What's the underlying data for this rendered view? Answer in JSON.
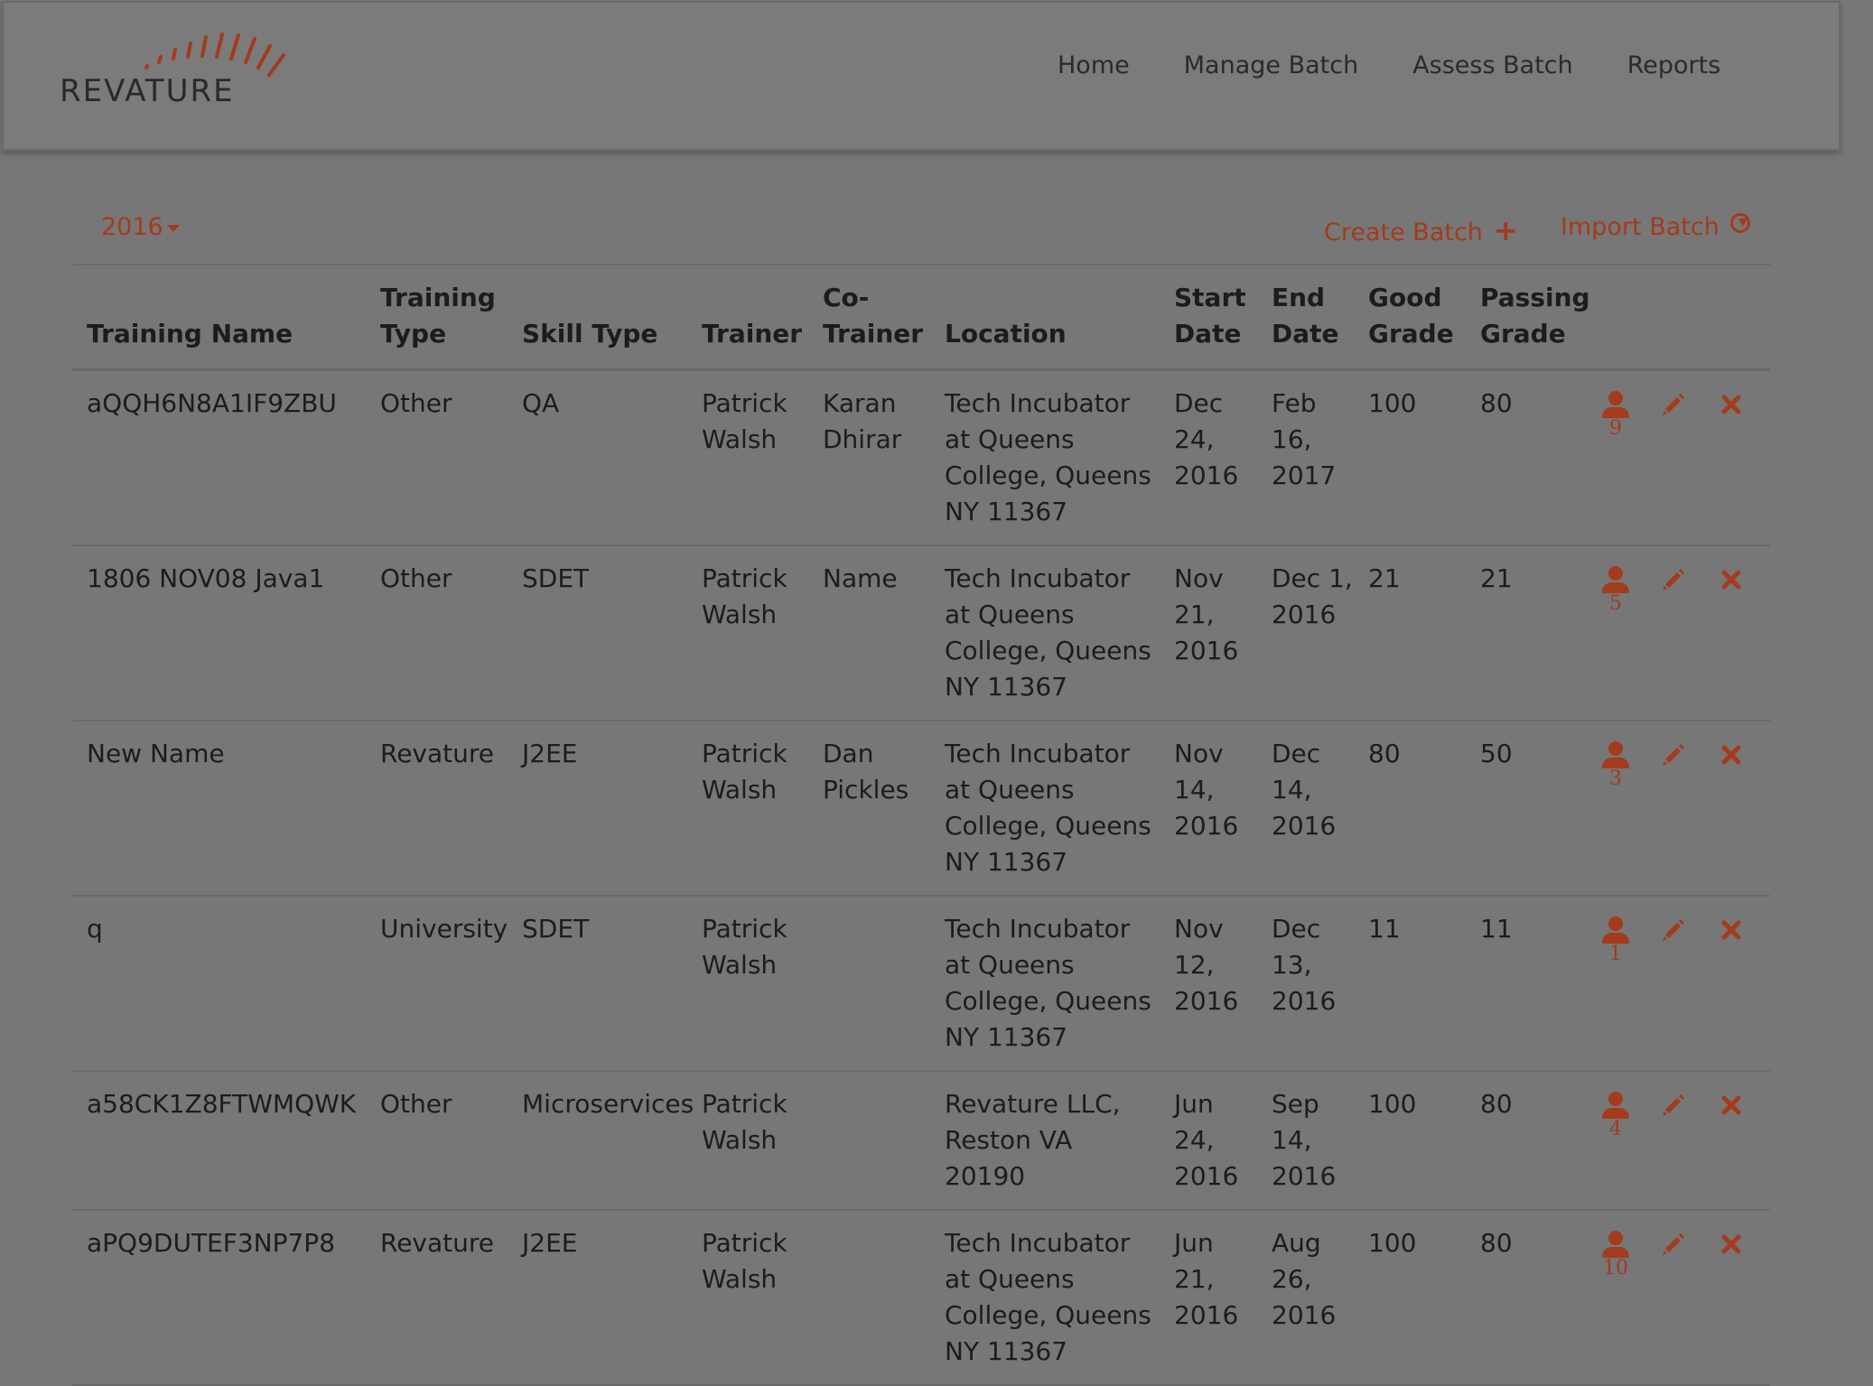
{
  "brand": {
    "name": "REVATURE",
    "accent": "#a33b1c"
  },
  "nav": {
    "items": [
      "Home",
      "Manage Batch",
      "Assess Batch",
      "Reports"
    ]
  },
  "toolbar": {
    "year": "2016",
    "create_label": "Create Batch",
    "import_label": "Import Batch",
    "create_icon": "plus-icon",
    "import_icon": "circle-arrow-down-icon"
  },
  "table": {
    "headers": [
      "Training Name",
      "Training Type",
      "Skill Type",
      "Trainer",
      "Co-Trainer",
      "Location",
      "Start Date",
      "End Date",
      "Good Grade",
      "Passing Grade"
    ],
    "rows": [
      {
        "name": "aQQH6N8A1IF9ZBU",
        "type": "Other",
        "skill": "QA",
        "trainer": "Patrick Walsh",
        "cotrainer": "Karan Dhirar",
        "location": "Tech Incubator at Queens College, Queens NY 11367",
        "start": "Dec 24, 2016",
        "end": "Feb 16, 2017",
        "good": "100",
        "passing": "80",
        "trainees": "9"
      },
      {
        "name": "1806 NOV08 Java1",
        "type": "Other",
        "skill": "SDET",
        "trainer": "Patrick Walsh",
        "cotrainer": "Name",
        "location": "Tech Incubator at Queens College, Queens NY 11367",
        "start": "Nov 21, 2016",
        "end": "Dec 1, 2016",
        "good": "21",
        "passing": "21",
        "trainees": "5"
      },
      {
        "name": "New Name",
        "type": "Revature",
        "skill": "J2EE",
        "trainer": "Patrick Walsh",
        "cotrainer": "Dan Pickles",
        "location": "Tech Incubator at Queens College, Queens NY 11367",
        "start": "Nov 14, 2016",
        "end": "Dec 14, 2016",
        "good": "80",
        "passing": "50",
        "trainees": "3"
      },
      {
        "name": "q",
        "type": "University",
        "skill": "SDET",
        "trainer": "Patrick Walsh",
        "cotrainer": "",
        "location": "Tech Incubator at Queens College, Queens NY 11367",
        "start": "Nov 12, 2016",
        "end": "Dec 13, 2016",
        "good": "11",
        "passing": "11",
        "trainees": "1"
      },
      {
        "name": "a58CK1Z8FTWMQWK",
        "type": "Other",
        "skill": "Microservices",
        "trainer": "Patrick Walsh",
        "cotrainer": "",
        "location": "Revature LLC, Reston VA 20190",
        "start": "Jun 24, 2016",
        "end": "Sep 14, 2016",
        "good": "100",
        "passing": "80",
        "trainees": "4"
      },
      {
        "name": "aPQ9DUTEF3NP7P8",
        "type": "Revature",
        "skill": "J2EE",
        "trainer": "Patrick Walsh",
        "cotrainer": "",
        "location": "Tech Incubator at Queens College, Queens NY 11367",
        "start": "Jun 21, 2016",
        "end": "Aug 26, 2016",
        "good": "100",
        "passing": "80",
        "trainees": "10"
      }
    ]
  }
}
